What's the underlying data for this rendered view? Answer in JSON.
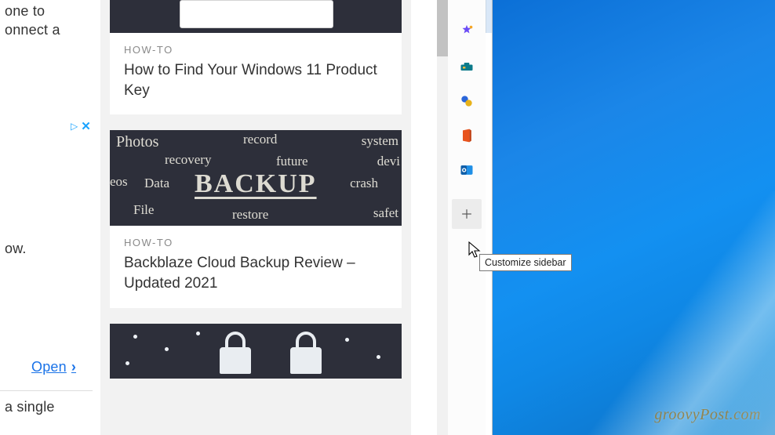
{
  "desktop": {
    "watermark": "groovyPost.com"
  },
  "left_panel": {
    "frag1": "one to onnect a",
    "frag2": "ow.",
    "open_label": "Open",
    "frag3": "a single"
  },
  "ad_controls": {
    "info_glyph": "▷",
    "close_glyph": "✕"
  },
  "cards": [
    {
      "category": "HOW-TO",
      "title": "How to Find Your Windows 11 Product Key"
    },
    {
      "category": "HOW-TO",
      "title": "Backblaze Cloud Backup Review – Updated 2021",
      "chalk_words": {
        "photos": "Photos",
        "record": "record",
        "system": "system",
        "recovery": "recovery",
        "future": "future",
        "devi": "devi",
        "eos": "eos",
        "data": "Data",
        "main": "BACKUP",
        "crash": "crash",
        "file": "File",
        "restore": "restore",
        "safet": "safet"
      }
    },
    {
      "category": "",
      "title": ""
    }
  ],
  "sidebar": {
    "icons": [
      {
        "name": "copilot-icon"
      },
      {
        "name": "tools-icon"
      },
      {
        "name": "games-icon"
      },
      {
        "name": "office-icon"
      },
      {
        "name": "outlook-icon"
      }
    ],
    "add_tooltip": "Customize sidebar"
  }
}
